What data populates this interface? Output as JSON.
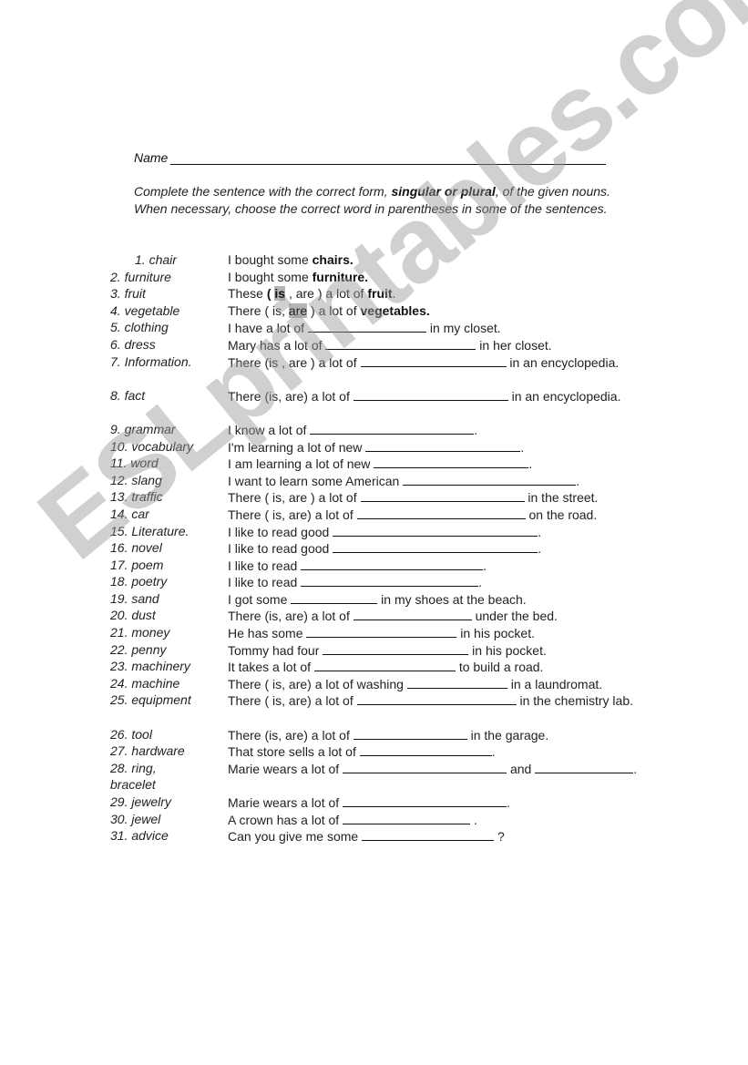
{
  "header": {
    "name_label": "Name",
    "instructions_pre": "Complete the sentence with the correct form, ",
    "instructions_bold": "singular or plural",
    "instructions_post": ", of the given nouns. When necessary, choose the correct word in parentheses in some of the sentences."
  },
  "watermark": "ESLprintables.com",
  "items": [
    {
      "num": "1.",
      "noun": "chair",
      "pre": "I bought some ",
      "bold": "chairs.",
      "post": ""
    },
    {
      "num": "2.",
      "noun": "furniture",
      "pre": "I bought some ",
      "bold": "furniture.",
      "post": ""
    },
    {
      "num": "3.",
      "noun": "fruit",
      "pre": "These ",
      "paren_open": "( ",
      "choice_a": "is",
      "mid": " , are ) a lot of ",
      "bold": "fruit",
      "post": "."
    },
    {
      "num": "4.",
      "noun": "vegetable",
      "pre": "There ( is, ",
      "choice_b": "are",
      "mid": " ) a lot of ",
      "bold": "vegetables.",
      "post": ""
    },
    {
      "num": "5.",
      "noun": "clothing",
      "pre": "I have a lot of ",
      "post": " in my closet."
    },
    {
      "num": "6.",
      "noun": "dress",
      "pre": "Mary has a lot of ",
      "post": " in her closet."
    },
    {
      "num": "7.",
      "noun": "Information.",
      "pre": "There (is , are )  a lot of ",
      "post": " in an encyclopedia."
    },
    {
      "num": "8.",
      "noun": "fact",
      "pre": "There (is, are) a lot of ",
      "post": " in an encyclopedia."
    },
    {
      "num": "9.",
      "noun": "grammar",
      "pre": "I know a lot of ",
      "post": "."
    },
    {
      "num": "10.",
      "noun": "vocabulary",
      "pre": "I'm learning a lot of new ",
      "post": "."
    },
    {
      "num": "11.",
      "noun": "word",
      "pre": "I am learning a lot of new ",
      "post": "."
    },
    {
      "num": "12.",
      "noun": "slang",
      "pre": "I want to learn some American ",
      "post": "."
    },
    {
      "num": "13.",
      "noun": "traffic",
      "pre": "There ( is, are ) a lot of ",
      "post": " in the street."
    },
    {
      "num": "14.",
      "noun": "car",
      "pre": "There ( is, are) a lot of ",
      "post": " on the road."
    },
    {
      "num": "15.",
      "noun": "Literature.",
      "pre": "I like to read good ",
      "post": "."
    },
    {
      "num": "16.",
      "noun": "novel",
      "pre": "I like to read good ",
      "post": "."
    },
    {
      "num": "17.",
      "noun": "poem",
      "pre": "I like to read ",
      "post": "."
    },
    {
      "num": "18.",
      "noun": "poetry",
      "pre": "I like to read ",
      "post": "."
    },
    {
      "num": "19.",
      "noun": "sand",
      "pre": "I got some ",
      "post": " in my shoes at the beach."
    },
    {
      "num": "20.",
      "noun": "dust",
      "pre": "There (is, are) a lot of ",
      "post": " under the bed."
    },
    {
      "num": "21.",
      "noun": "money",
      "pre": "He has some ",
      "post": "  in his pocket."
    },
    {
      "num": "22.",
      "noun": "penny",
      "pre": "Tommy had four ",
      "post": " in his pocket."
    },
    {
      "num": "23.",
      "noun": "machinery",
      "pre": "It takes a lot of ",
      "post": " to build a road."
    },
    {
      "num": "24.",
      "noun": "machine",
      "pre": "There ( is, are) a lot of washing ",
      "post": " in a laundromat."
    },
    {
      "num": "25.",
      "noun": "equipment",
      "pre": "There ( is, are) a lot of ",
      "post": " in the chemistry lab."
    },
    {
      "num": "26.",
      "noun": "tool",
      "pre": "There (is, are) a lot of ",
      "post": " in the garage."
    },
    {
      "num": "27.",
      "noun": "hardware",
      "pre": "That store sells a lot of ",
      "post": "."
    },
    {
      "num": "28.",
      "noun": "ring, bracelet",
      "pre": "Marie wears a lot of ",
      "post": " and ",
      "post2": "."
    },
    {
      "num": "29.",
      "noun": "jewelry",
      "pre": "Marie wears a lot of ",
      "post": "."
    },
    {
      "num": "30.",
      "noun": "jewel",
      "pre": "A crown has a lot of ",
      "post": " ."
    },
    {
      "num": "31.",
      "noun": "advice",
      "pre": "Can you give me some ",
      "post": " ?"
    }
  ]
}
